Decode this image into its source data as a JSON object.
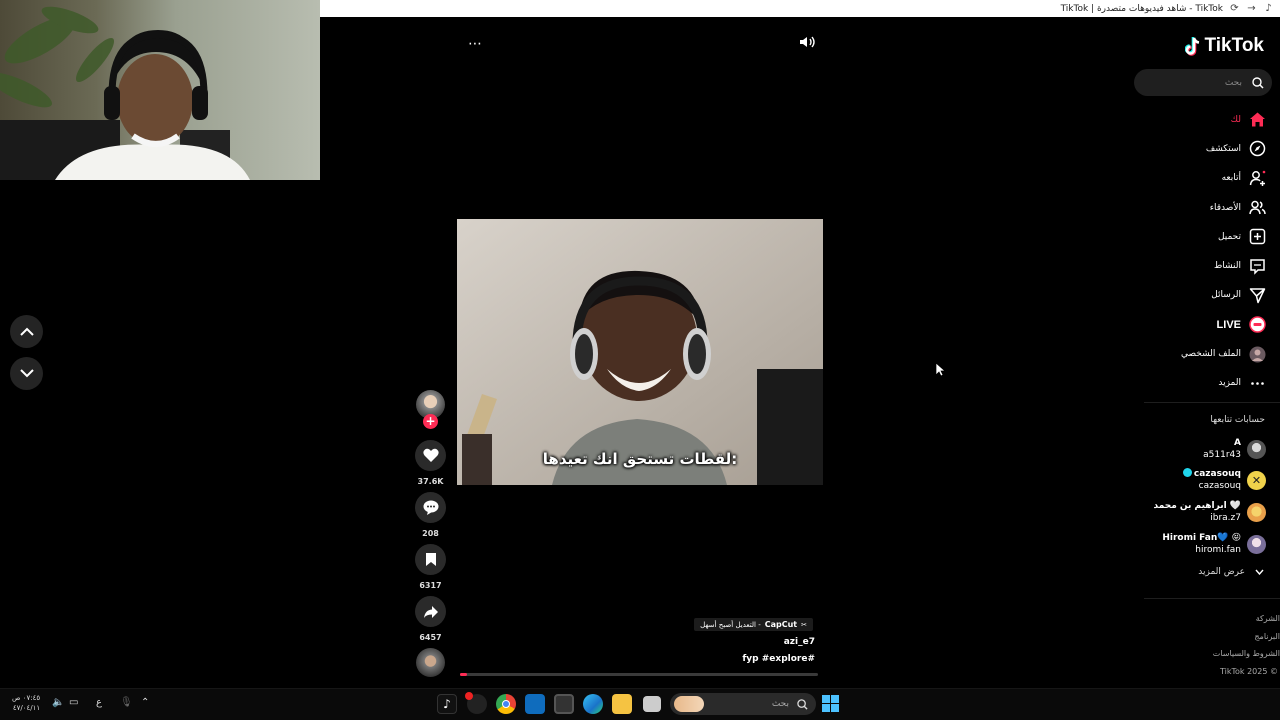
{
  "window": {
    "title": "TikTok | شاهد فيديوهات متصدرة - TikTok"
  },
  "sidebar": {
    "logo": "TikTok",
    "search_placeholder": "بحث",
    "nav": [
      {
        "label": "لك",
        "icon": "home-icon",
        "active": true
      },
      {
        "label": "استكشف",
        "icon": "compass-icon"
      },
      {
        "label": "أتابعه",
        "icon": "following-icon"
      },
      {
        "label": "الأصدقاء",
        "icon": "friends-icon"
      },
      {
        "label": "تحميل",
        "icon": "upload-icon"
      },
      {
        "label": "النشاط",
        "icon": "activity-icon"
      },
      {
        "label": "الرسائل",
        "icon": "messages-icon"
      },
      {
        "label": "LIVE",
        "icon": "live-icon"
      },
      {
        "label": "الملف الشخصي",
        "icon": "profile-avatar"
      },
      {
        "label": "المزيد",
        "icon": "more-icon"
      }
    ],
    "following_title": "حسابات تتابعها",
    "accounts": [
      {
        "name": "A",
        "handle": "a511r43"
      },
      {
        "name": "cazasouq",
        "handle": "cazasouq",
        "verified": true
      },
      {
        "name": "ابراهيم بن محمد 🤍",
        "handle": "ibra.z7"
      },
      {
        "name": "Hiromi Fan💙 😝",
        "handle": "hiromi.fan"
      }
    ],
    "show_more": "عرض المزيد",
    "footer": [
      "الشركة",
      "البرنامج",
      "الشروط والسياسات",
      "TikTok 2025 ©"
    ]
  },
  "video": {
    "subtitle": "لقطات تستحق انك تعيدها:",
    "capcut_brand": "CapCut",
    "capcut_text": "التعديل أصبح أسهل -",
    "author": "azi_e7",
    "tags": "#fyp #explore",
    "progress": 0.01
  },
  "actions": {
    "likes": "37.6K",
    "comments": "208",
    "saves": "6317",
    "shares": "6457"
  },
  "taskbar": {
    "search_placeholder": "بحث",
    "time": "٠٧:٤٥ ص",
    "date": "٤٧/٠٤/١١",
    "lang": "ع"
  },
  "colors": {
    "accent": "#fe2c55",
    "background": "#000000",
    "teal": "#25f4ee"
  }
}
